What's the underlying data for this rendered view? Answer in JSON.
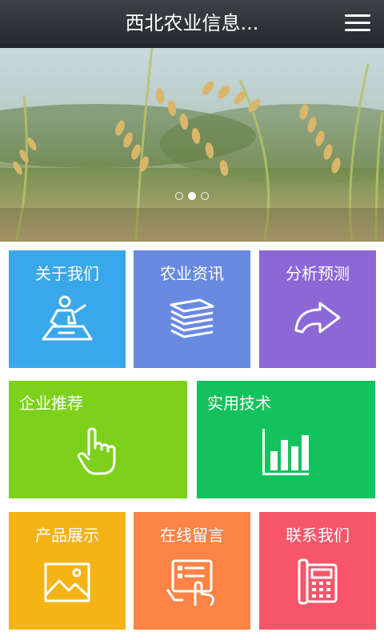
{
  "header": {
    "title": "西北农业信息...",
    "menu_icon": "hamburger-menu-icon"
  },
  "banner": {
    "slide_count": 3,
    "active_index": 1
  },
  "tiles": [
    {
      "label": "关于我们",
      "icon": "person-at-desk-icon",
      "color": "#39a8ea"
    },
    {
      "label": "农业资讯",
      "icon": "stacked-papers-icon",
      "color": "#6a89e0"
    },
    {
      "label": "分析预测",
      "icon": "return-arrow-icon",
      "color": "#8c67d6"
    },
    {
      "label": "企业推荐",
      "icon": "pointing-hand-icon",
      "color": "#7ed11a"
    },
    {
      "label": "实用技术",
      "icon": "bar-chart-icon",
      "color": "#14c25d"
    },
    {
      "label": "产品展示",
      "icon": "picture-icon",
      "color": "#f4b315"
    },
    {
      "label": "在线留言",
      "icon": "tablet-touch-icon",
      "color": "#fb8446"
    },
    {
      "label": "联系我们",
      "icon": "telephone-icon",
      "color": "#f6566a"
    }
  ]
}
